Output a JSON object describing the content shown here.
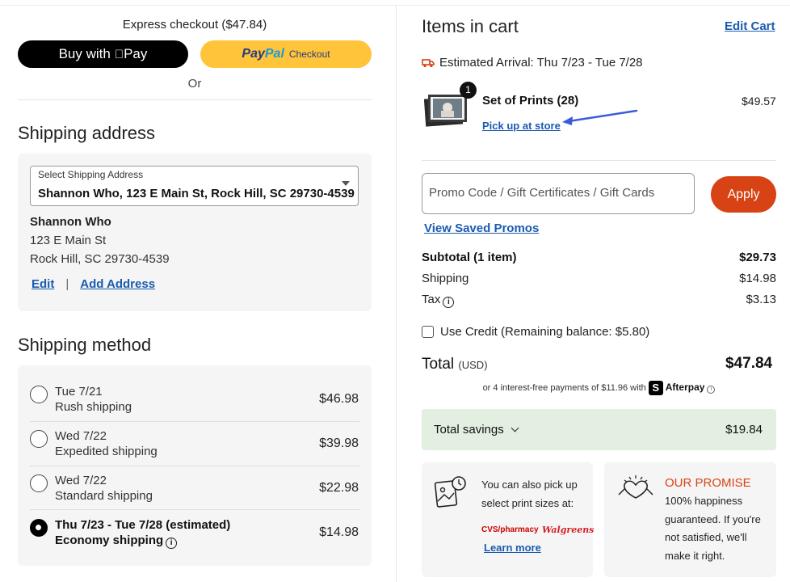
{
  "express": {
    "title": "Express checkout ($47.84)",
    "applepay_label": "Buy with",
    "applepay_brand": "Pay",
    "paypal_part1": "Pay",
    "paypal_part2": "Pal",
    "paypal_checkout": "Checkout",
    "or": "Or"
  },
  "shipping_address": {
    "title": "Shipping address",
    "select_label": "Select Shipping Address",
    "select_value": "Shannon Who, 123 E Main St, Rock Hill, SC 29730-4539",
    "name": "Shannon Who",
    "street": "123 E Main St",
    "city_line": "Rock Hill, SC 29730-4539",
    "edit_label": "Edit",
    "separator": "|",
    "add_label": "Add Address"
  },
  "shipping_method": {
    "title": "Shipping method",
    "options": [
      {
        "date": "Tue 7/21",
        "name": "Rush shipping",
        "price": "$46.98",
        "selected": false
      },
      {
        "date": "Wed 7/22",
        "name": "Expedited shipping",
        "price": "$39.98",
        "selected": false
      },
      {
        "date": "Wed 7/22",
        "name": "Standard shipping",
        "price": "$22.98",
        "selected": false
      },
      {
        "date": "Thu 7/23 - Tue 7/28 (estimated)",
        "name": "Economy shipping",
        "price": "$14.98",
        "selected": true
      }
    ]
  },
  "cart": {
    "title": "Items in cart",
    "edit_label": "Edit Cart",
    "arrival": "Estimated Arrival: Thu 7/23 - Tue 7/28",
    "item": {
      "name": "Set of Prints (28)",
      "price": "$49.57",
      "qty": "1",
      "pickup_label": "Pick up at store"
    },
    "promo_placeholder": "Promo Code / Gift Certificates / Gift Cards",
    "apply_label": "Apply",
    "saved_promos_label": "View Saved Promos"
  },
  "summary": {
    "subtotal_label": "Subtotal (1 item)",
    "subtotal": "$29.73",
    "shipping_label": "Shipping",
    "shipping": "$14.98",
    "tax_label": "Tax",
    "tax": "$3.13",
    "credit_label": "Use Credit (Remaining balance: $5.80)",
    "total_label": "Total",
    "total_currency": "(USD)",
    "total": "$47.84",
    "afterpay_text": "or 4 interest-free payments of $11.96 with",
    "afterpay_brand": "Afterpay",
    "savings_label": "Total savings",
    "savings": "$19.84"
  },
  "pickup_card": {
    "line1": "You can also pick up",
    "line2": "select print sizes at:",
    "cvs": "CVS/pharmacy",
    "walgreens": "Walgreens",
    "learn_more": "Learn more"
  },
  "promise_card": {
    "title": "OUR PROMISE",
    "line1": "100% happiness",
    "line2": "guaranteed. If you're",
    "line3": "not satisfied, we'll",
    "line4": "make it right."
  },
  "colors": {
    "accent": "#d84315",
    "link": "#1a5bb0",
    "savings_bg": "#e3f0e1",
    "paypal": "#ffc439",
    "arrow": "#3b5bdb"
  }
}
